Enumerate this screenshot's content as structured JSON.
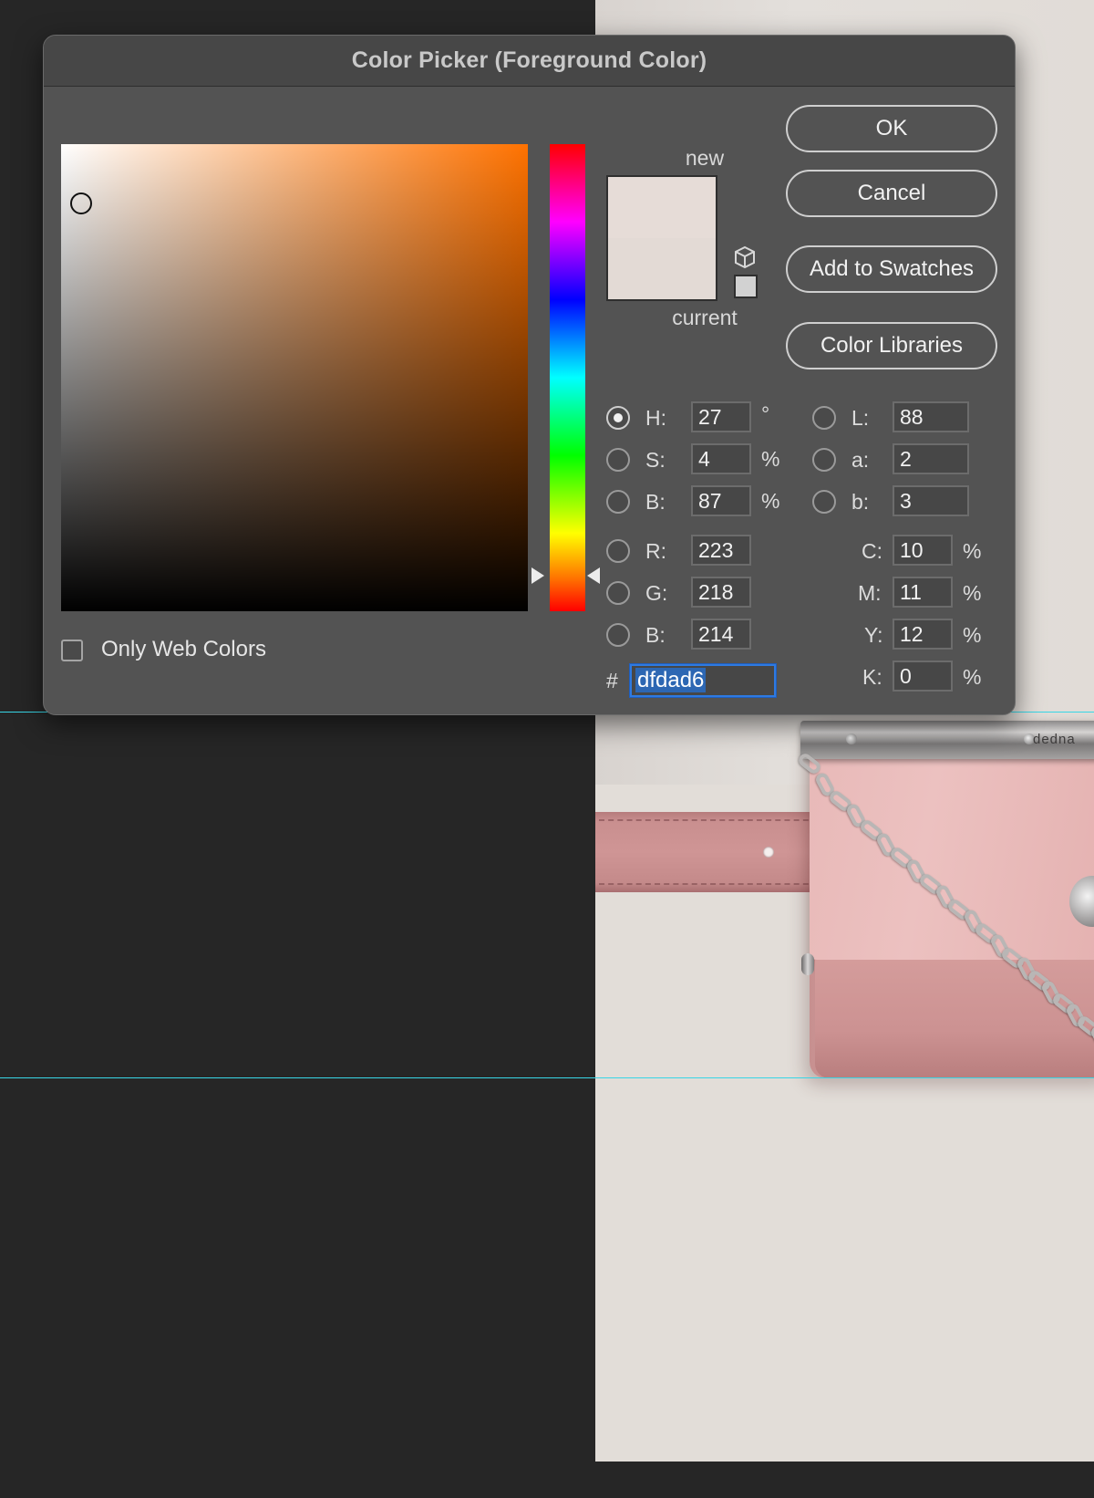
{
  "dialog": {
    "title": "Color Picker (Foreground Color)",
    "new_label": "new",
    "current_label": "current",
    "new_color": "#e6dcd7",
    "current_color": "#e3dad5",
    "hue_marker_color": "#ff7200"
  },
  "buttons": {
    "ok": "OK",
    "cancel": "Cancel",
    "add_to_swatches": "Add to Swatches",
    "color_libraries": "Color Libraries"
  },
  "hsb": {
    "h": {
      "label": "H:",
      "value": "27",
      "unit": "°",
      "selected": true
    },
    "s": {
      "label": "S:",
      "value": "4",
      "unit": "%",
      "selected": false
    },
    "b": {
      "label": "B:",
      "value": "87",
      "unit": "%",
      "selected": false
    }
  },
  "lab": {
    "l": {
      "label": "L:",
      "value": "88"
    },
    "a": {
      "label": "a:",
      "value": "2"
    },
    "b": {
      "label": "b:",
      "value": "3"
    }
  },
  "rgb": {
    "r": {
      "label": "R:",
      "value": "223"
    },
    "g": {
      "label": "G:",
      "value": "218"
    },
    "b": {
      "label": "B:",
      "value": "214"
    }
  },
  "cmyk": {
    "c": {
      "label": "C:",
      "value": "10",
      "unit": "%"
    },
    "m": {
      "label": "M:",
      "value": "11",
      "unit": "%"
    },
    "y": {
      "label": "Y:",
      "value": "12",
      "unit": "%"
    },
    "k": {
      "label": "K:",
      "value": "0",
      "unit": "%"
    }
  },
  "hex": {
    "hash": "#",
    "value": "dfdad6"
  },
  "web_colors": {
    "label": "Only Web Colors",
    "checked": false
  },
  "icons": {
    "gamut": "cube-icon",
    "websafe": "websafe-swatch"
  },
  "canvas": {
    "brand_text": "dedna",
    "guide_color": "#38d6e6"
  }
}
